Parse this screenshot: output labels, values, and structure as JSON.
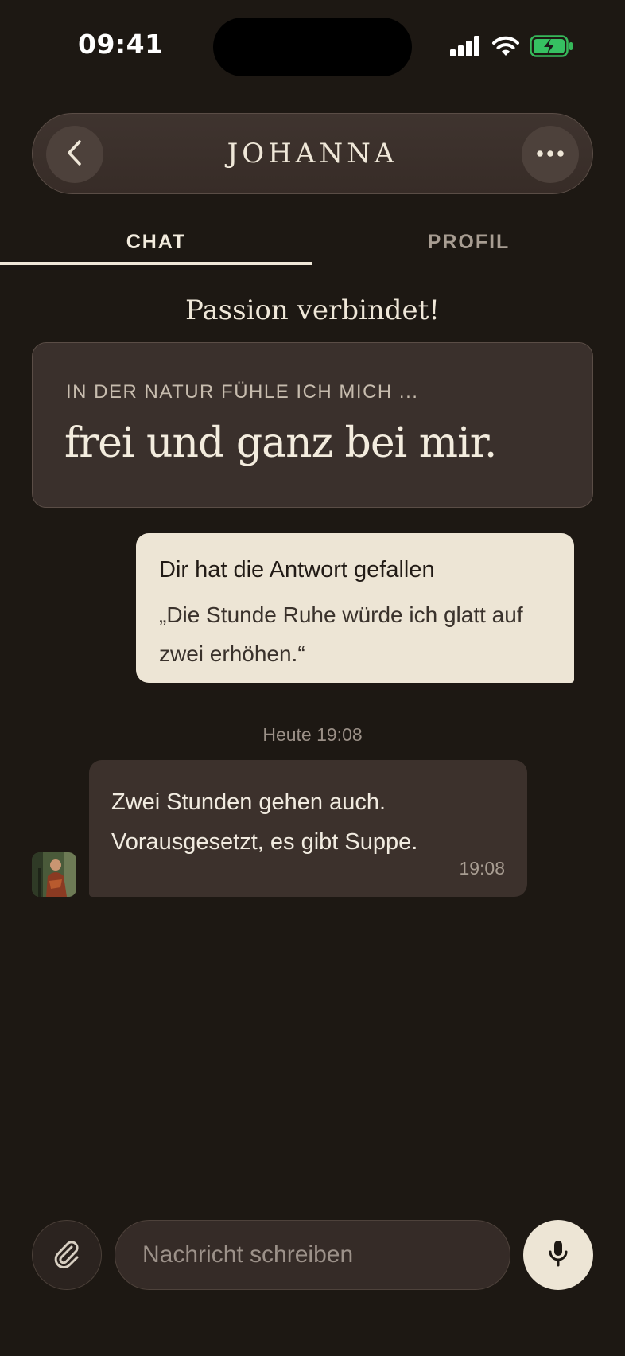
{
  "status_bar": {
    "time": "09:41"
  },
  "header": {
    "title": "JOHANNA",
    "back_icon": "chevron-left-icon",
    "more_icon": "ellipsis-icon"
  },
  "tabs": [
    {
      "label": "CHAT",
      "active": true
    },
    {
      "label": "PROFIL",
      "active": false
    }
  ],
  "chat": {
    "section_title": "Passion verbindet!",
    "prompt": {
      "question": "IN DER NATUR FÜHLE ICH MICH ...",
      "answer": "frei und ganz bei mir."
    },
    "liked_answer": {
      "title": "Dir hat die Antwort gefallen",
      "quote": "„Die Stunde Ruhe würde ich glatt auf zwei erhöhen.“"
    },
    "date_separator": "Heute 19:08",
    "incoming_message": {
      "text": "Zwei Stunden gehen auch. Vorausgesetzt, es gibt Suppe.",
      "time": "19:08"
    }
  },
  "composer": {
    "placeholder": "Nachricht schreiben",
    "attach_icon": "paperclip-icon",
    "mic_icon": "microphone-icon"
  },
  "colors": {
    "background": "#1d1813",
    "card": "#3a302c",
    "accent_cream": "#ede5d5",
    "text_light": "#efe7d8"
  }
}
